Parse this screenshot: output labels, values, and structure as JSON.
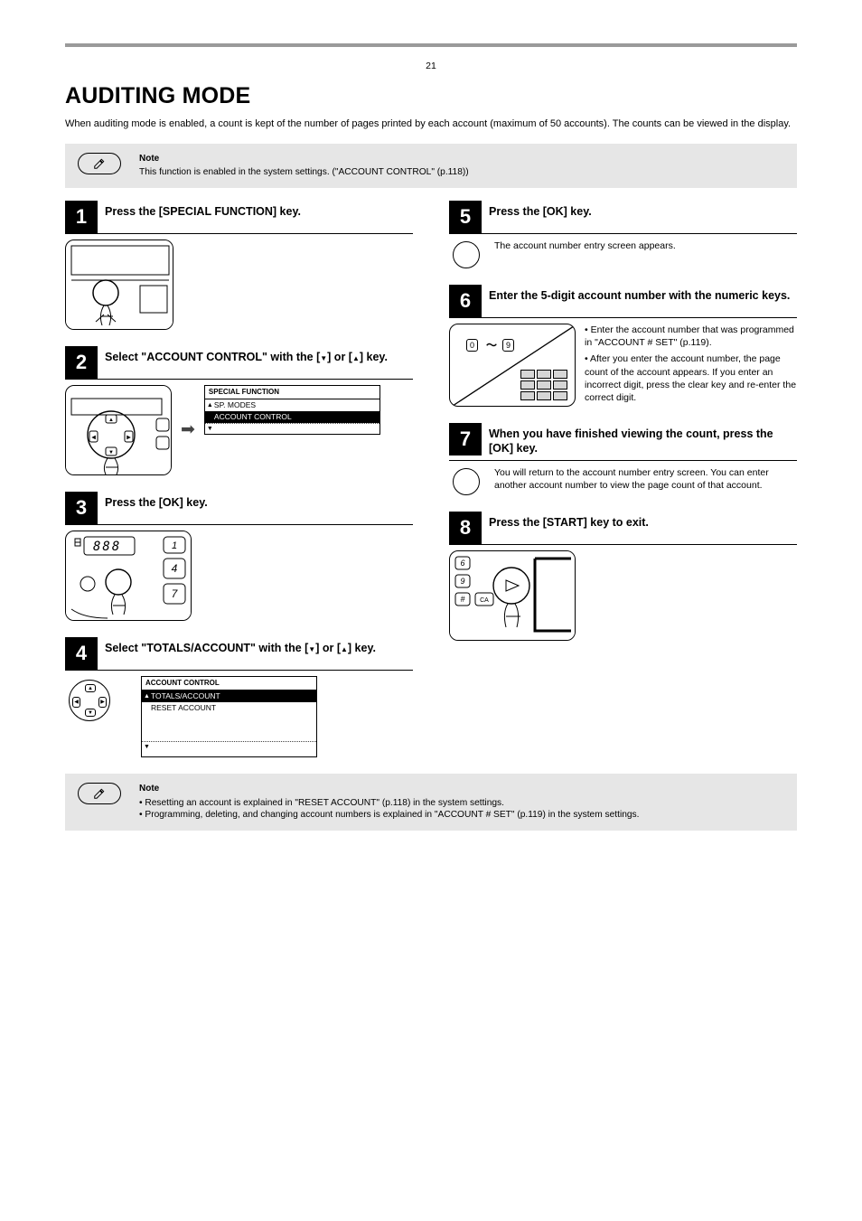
{
  "page_number": "21",
  "title": "AUDITING MODE",
  "intro": "When auditing mode is enabled, a count is kept of the number of pages printed by each account (maximum of 50 accounts). The counts can be viewed in the display.",
  "note1": {
    "label": "Note",
    "text": "This function is enabled in the system settings. (\"ACCOUNT CONTROL\" (p.118))"
  },
  "steps": {
    "s1": {
      "num": "1",
      "title": "Press the [SPECIAL FUNCTION] key."
    },
    "s2": {
      "num": "2",
      "title_pre": "Select \"ACCOUNT CONTROL\" with the [",
      "title_mid": "] or [",
      "title_post": "] key.",
      "screen": {
        "header": "SPECIAL FUNCTION",
        "row1": "SP. MODES",
        "row2": "ACCOUNT CONTROL",
        "row3": ""
      }
    },
    "s3": {
      "num": "3",
      "title": "Press the [OK] key."
    },
    "s4": {
      "num": "4",
      "title_pre": "Select \"TOTALS/ACCOUNT\" with the [",
      "title_mid": "] or [",
      "title_post": "] key.",
      "screen": {
        "header": "ACCOUNT CONTROL",
        "row1": "TOTALS/ACCOUNT",
        "row2": "RESET ACCOUNT",
        "row3": ""
      }
    },
    "s5": {
      "num": "5",
      "title": "Press the [OK] key.",
      "body": "The account number entry screen appears."
    },
    "s6": {
      "num": "6",
      "title": "Enter the 5-digit account number with the numeric keys.",
      "line1": "• Enter the account number that was programmed in \"ACCOUNT # SET\" (p.119).",
      "line2": "• After you enter the account number, the page count of the account appears. If you enter an incorrect digit, press the clear key and re-enter the correct digit.",
      "tilde": "～",
      "key0": "0",
      "key9": "9"
    },
    "s7": {
      "num": "7",
      "title": "When you have finished viewing the count, press the [OK] key.",
      "body": "You will return to the account number entry screen. You can enter another account number to view the page count of that account."
    },
    "s8": {
      "num": "8",
      "title": "Press the [START] key to exit.",
      "key6": "6",
      "key9": "9",
      "keyhash": "#",
      "keyCA": "CA"
    }
  },
  "note2": {
    "label": "Note",
    "line1": "• Resetting an account is explained in \"RESET ACCOUNT\" (p.118) in the system settings.",
    "line2": "• Programming, deleting, and changing account numbers is explained in \"ACCOUNT # SET\" (p.119) in the system settings."
  }
}
